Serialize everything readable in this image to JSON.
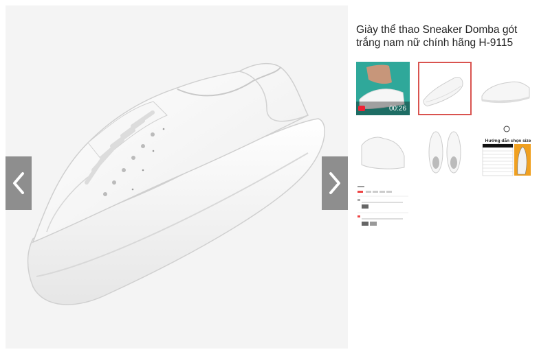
{
  "product": {
    "title": "Giày thể thao Sneaker Domba gót trắng nam nữ chính hãng H-9115"
  },
  "gallery": {
    "prev_icon": "chevron-left-icon",
    "next_icon": "chevron-right-icon",
    "thumbnails": [
      {
        "kind": "video",
        "duration": "00:26",
        "selected": false
      },
      {
        "kind": "image",
        "selected": true
      },
      {
        "kind": "image",
        "selected": false
      },
      {
        "kind": "image",
        "selected": false
      },
      {
        "kind": "image",
        "selected": false
      },
      {
        "kind": "size-guide",
        "caption": "Hướng dẫn chọn size",
        "selected": false
      },
      {
        "kind": "screenshot",
        "selected": false
      }
    ]
  },
  "colors": {
    "selected_border": "#d9534f",
    "nav_overlay": "rgba(0,0,0,0.42)"
  }
}
